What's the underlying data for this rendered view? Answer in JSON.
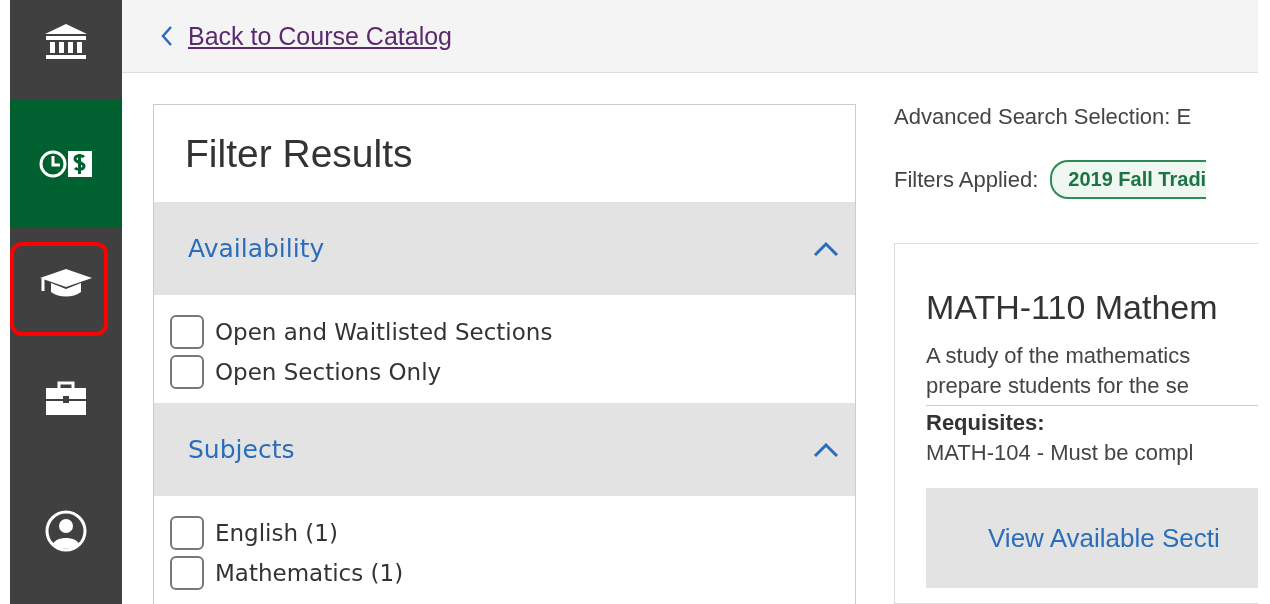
{
  "sidebar": {
    "items": [
      {
        "selected": false,
        "highlighted": false
      },
      {
        "selected": true,
        "highlighted": false
      },
      {
        "selected": false,
        "highlighted": true
      },
      {
        "selected": false,
        "highlighted": false
      },
      {
        "selected": false,
        "highlighted": false
      }
    ]
  },
  "top_bar": {
    "back_link": "Back to Course Catalog"
  },
  "filter_panel": {
    "title": "Filter Results",
    "sections": [
      {
        "title": "Availability",
        "expanded": true,
        "options": [
          {
            "label": "Open and Waitlisted Sections",
            "checked": false
          },
          {
            "label": "Open Sections Only",
            "checked": false
          }
        ]
      },
      {
        "title": "Subjects",
        "expanded": true,
        "options": [
          {
            "label": "English (1)",
            "checked": false
          },
          {
            "label": "Mathematics (1)",
            "checked": false
          }
        ]
      }
    ]
  },
  "results": {
    "search_selection": "Advanced Search Selection: E",
    "filters_label": "Filters Applied:",
    "filter_chips": [
      "2019 Fall Tradi"
    ],
    "course": {
      "title": "MATH-110 Mathem",
      "description": [
        "A study of the mathematics",
        "prepare students for the se"
      ],
      "requisites_label": "Requisites:",
      "requisites": "MATH-104 - Must be compl",
      "sections_button": "View Available Secti"
    }
  }
}
